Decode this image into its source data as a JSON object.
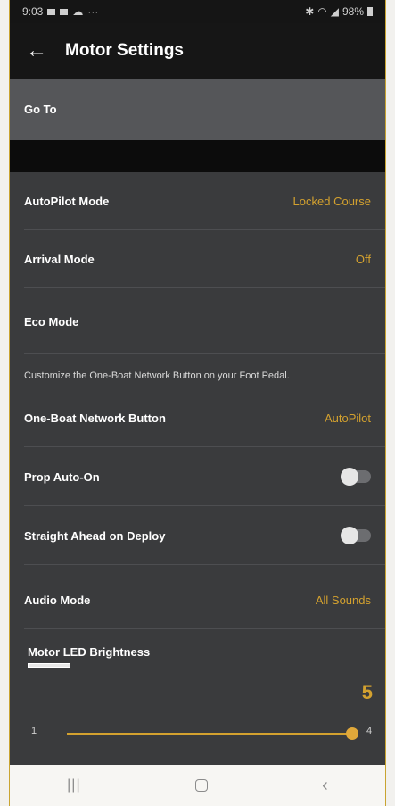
{
  "status_bar": {
    "time": "9:03",
    "battery": "98%"
  },
  "header": {
    "title": "Motor Settings"
  },
  "goto": {
    "label": "Go To"
  },
  "settings": {
    "autopilot": {
      "label": "AutoPilot Mode",
      "value": "Locked Course"
    },
    "arrival": {
      "label": "Arrival Mode",
      "value": "Off"
    },
    "eco": {
      "label": "Eco Mode"
    },
    "hint": "Customize the One-Boat Network Button on your Foot Pedal.",
    "one_boat": {
      "label": "One-Boat Network Button",
      "value": "AutoPilot"
    },
    "prop_auto_on": {
      "label": "Prop Auto-On",
      "enabled": false
    },
    "straight_ahead": {
      "label": "Straight Ahead on Deploy",
      "enabled": false
    },
    "audio": {
      "label": "Audio Mode",
      "value": "All Sounds"
    },
    "brightness": {
      "label": "Motor LED Brightness",
      "value": "5",
      "min": "1",
      "max": "4"
    }
  },
  "colors": {
    "accent": "#d3a12f",
    "background": "#3a3b3d",
    "header": "#161616"
  },
  "icons": {
    "back": "arrow-left-icon",
    "nav_recents": "recents-icon",
    "nav_home": "home-icon",
    "nav_back": "chevron-left-icon"
  }
}
